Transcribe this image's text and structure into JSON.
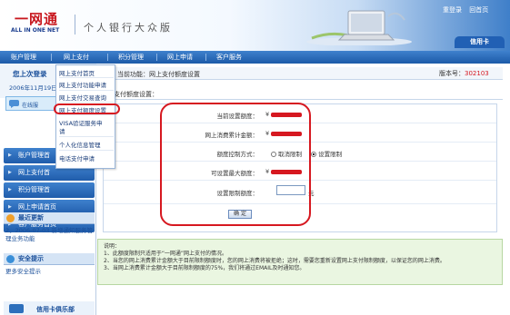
{
  "brand": {
    "logo_cn": "一网通",
    "logo_en": "ALL IN ONE NET",
    "site_title": "个人银行大众版"
  },
  "top_links": [
    "重登录",
    "回首页"
  ],
  "card_tab": "信用卡",
  "nav": [
    "账户管理",
    "网上支付",
    "积分管理",
    "网上申请",
    "客户服务"
  ],
  "sidebar": {
    "welcome_title": "您上次登录",
    "date": "2006年11月19日",
    "online_label": "在线服",
    "menu": [
      "账户管理首",
      "网上支付首",
      "积分管理首",
      "网上申请首页",
      "客户服务首页"
    ],
    "latest_title": "最近更新",
    "latest_text": "2、2006-07-03 新增通知服务管理业务功能",
    "security_title": "安全提示",
    "security_text": "更多安全提示",
    "club_text": "信用卡俱乐部"
  },
  "dropdown": [
    "网上支付首页",
    "网上支付功能申请",
    "网上支付交易查询",
    "网上支付额度设置",
    "VISA验证服务申",
    "请",
    "个人化信息管理",
    "电话支付申请"
  ],
  "main": {
    "crumb": "当前功能：网上支付额度设置",
    "version_label": "版本号：",
    "version": "302103",
    "section_title": "网上支付额度设置：",
    "fields": {
      "current_limit": "当前设置额度：",
      "current_prefix": "¥",
      "total_spent": "网上消费累计金额：",
      "total_prefix": "¥",
      "mode_label": "额度控制方式：",
      "mode_cancel": "取消限制",
      "mode_set": "设置限制",
      "max_limit": "可设置最大额度：",
      "max_prefix": "¥",
      "set_label": "设置限制额度：",
      "unit": "元"
    },
    "confirm": "确 定",
    "notes": [
      "说明：",
      "1、此额度限制只适用于“一网通”网上支付的情况。",
      "2、当您的网上消费累计金额大于目前限制额度时，您的网上消费将被拒绝；这时，需要您重新设置网上支付限制额度，以保证您的网上消费。",
      "3、当网上消费累计金额大于目前限制额度的75%，我们将通过EMAIL及时通知您。"
    ]
  },
  "colors": {
    "brand_blue": "#1c5aa8",
    "highlight_red": "#d61820",
    "notes_bg": "#eaf6e1"
  }
}
